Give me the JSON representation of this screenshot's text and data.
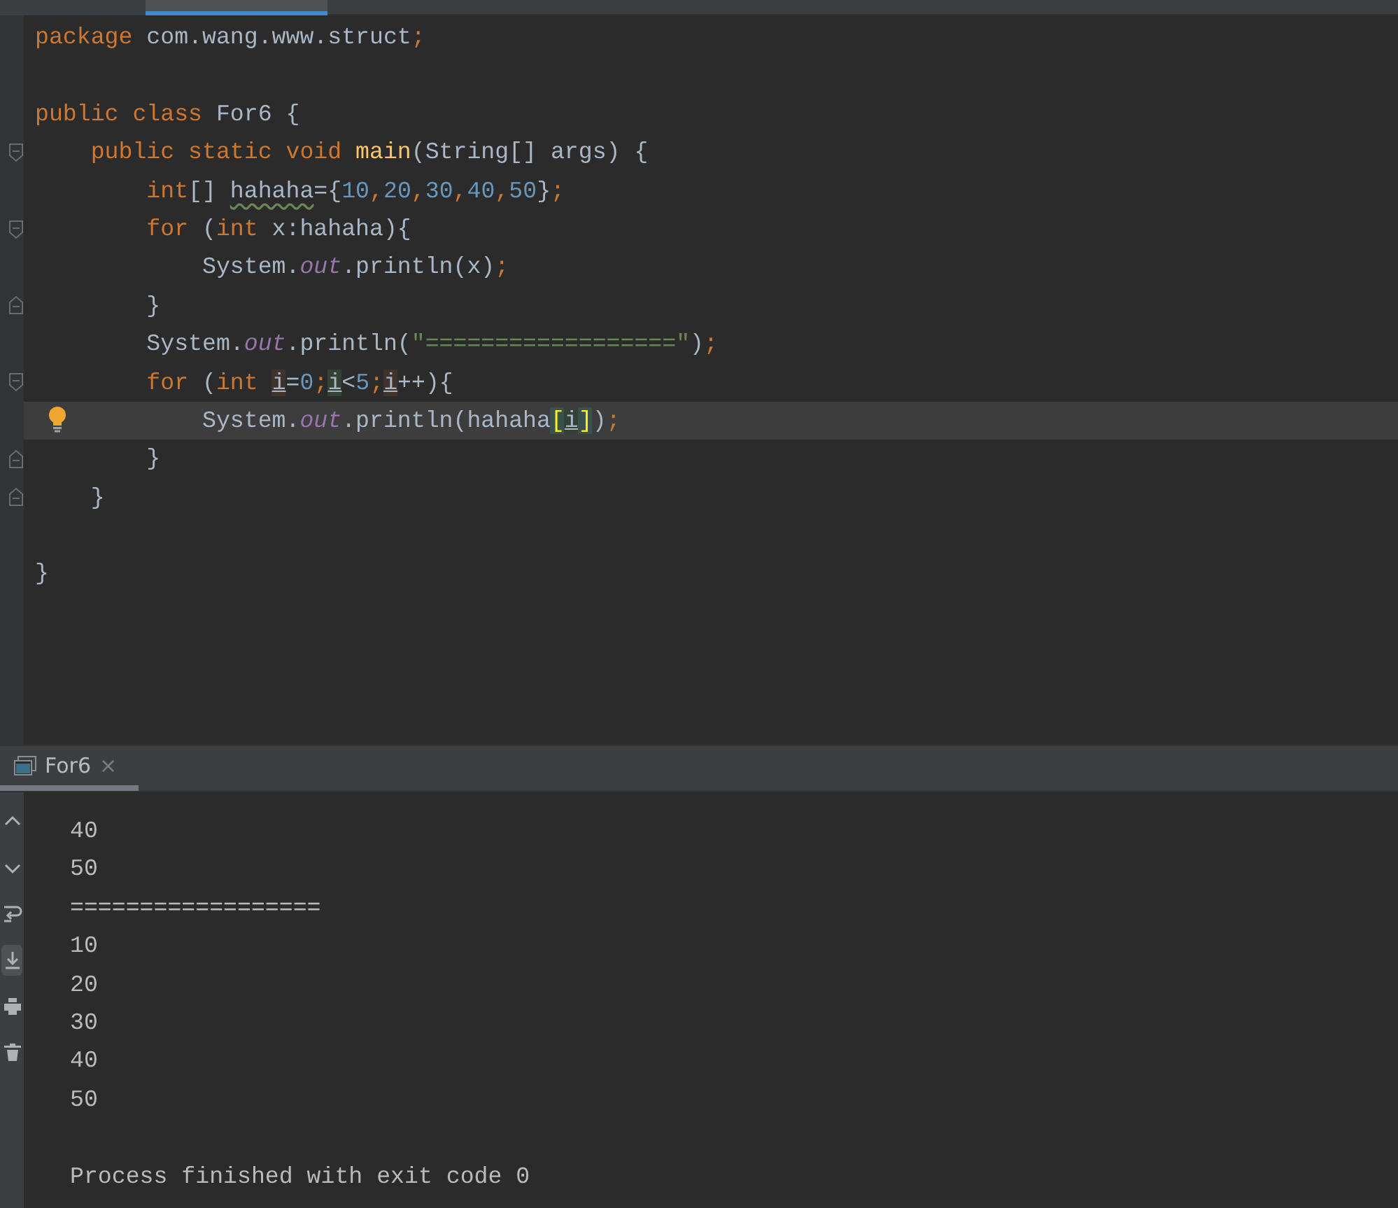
{
  "editor_tabs": [
    {
      "selected": false
    },
    {
      "selected": true
    }
  ],
  "code_lines": [
    {
      "kind": "plain",
      "current": false,
      "tokens": [
        {
          "kind": "kw",
          "text": "package"
        },
        {
          "kind": "id",
          "text": " com.wang.www.struct"
        },
        {
          "kind": "kw",
          "text": ";"
        }
      ]
    },
    {
      "kind": "plain",
      "current": false
    },
    {
      "kind": "plain",
      "current": false,
      "tokens": [
        {
          "kind": "kw",
          "text": "public class"
        },
        {
          "kind": "id",
          "text": " For6 {"
        }
      ]
    },
    {
      "kind": "fold-start",
      "current": false,
      "tokens": [
        {
          "kind": "kw",
          "text": "    public static void "
        },
        {
          "kind": "fn",
          "text": "main"
        },
        {
          "kind": "id",
          "text": "(String[] args) {"
        }
      ]
    },
    {
      "kind": "plain",
      "current": false,
      "tokens": [
        {
          "kind": "kw",
          "text": "        int"
        },
        {
          "kind": "id",
          "text": "[] "
        },
        {
          "kind": "warn",
          "text": "hahaha"
        },
        {
          "kind": "id",
          "text": "={"
        },
        {
          "kind": "num",
          "text": "10"
        },
        {
          "kind": "kw",
          "text": ","
        },
        {
          "kind": "num",
          "text": "20"
        },
        {
          "kind": "kw",
          "text": ","
        },
        {
          "kind": "num",
          "text": "30"
        },
        {
          "kind": "kw",
          "text": ","
        },
        {
          "kind": "num",
          "text": "40"
        },
        {
          "kind": "kw",
          "text": ","
        },
        {
          "kind": "num",
          "text": "50"
        },
        {
          "kind": "id",
          "text": "}"
        },
        {
          "kind": "kw",
          "text": ";"
        }
      ]
    },
    {
      "kind": "fold-start",
      "current": false,
      "tokens": [
        {
          "kind": "kw",
          "text": "        for"
        },
        {
          "kind": "id",
          "text": " ("
        },
        {
          "kind": "kw",
          "text": "int"
        },
        {
          "kind": "id",
          "text": " x:hahaha){"
        }
      ]
    },
    {
      "kind": "plain",
      "current": false,
      "tokens": [
        {
          "kind": "id",
          "text": "            System."
        },
        {
          "kind": "field",
          "text": "out"
        },
        {
          "kind": "id",
          "text": ".println(x)"
        },
        {
          "kind": "kw",
          "text": ";"
        }
      ]
    },
    {
      "kind": "fold-end",
      "current": false,
      "tokens": [
        {
          "kind": "id",
          "text": "        }"
        }
      ]
    },
    {
      "kind": "plain",
      "current": false,
      "tokens": [
        {
          "kind": "id",
          "text": "        System."
        },
        {
          "kind": "field",
          "text": "out"
        },
        {
          "kind": "id",
          "text": ".println("
        },
        {
          "kind": "str",
          "text": "\"==================\""
        },
        {
          "kind": "id",
          "text": ")"
        },
        {
          "kind": "kw",
          "text": ";"
        }
      ]
    },
    {
      "kind": "fold-start",
      "current": false,
      "tokens": [
        {
          "kind": "kw",
          "text": "        for"
        },
        {
          "kind": "id",
          "text": " ("
        },
        {
          "kind": "kw",
          "text": "int "
        },
        {
          "kind": "var-write",
          "text": "i"
        },
        {
          "kind": "id",
          "text": "="
        },
        {
          "kind": "num",
          "text": "0"
        },
        {
          "kind": "kw",
          "text": ";"
        },
        {
          "kind": "var-read",
          "text": "i"
        },
        {
          "kind": "id",
          "text": "<"
        },
        {
          "kind": "num",
          "text": "5"
        },
        {
          "kind": "kw",
          "text": ";"
        },
        {
          "kind": "var-write",
          "text": "i"
        },
        {
          "kind": "id",
          "text": "++){"
        }
      ]
    },
    {
      "kind": "bulb",
      "current": true,
      "tokens": [
        {
          "kind": "id",
          "text": "            System."
        },
        {
          "kind": "field",
          "text": "out"
        },
        {
          "kind": "id",
          "text": ".println(hahaha"
        },
        {
          "kind": "match",
          "text": "["
        },
        {
          "kind": "var-read",
          "text": "i"
        },
        {
          "kind": "match",
          "text": "]"
        },
        {
          "kind": "id",
          "text": ")"
        },
        {
          "kind": "kw",
          "text": ";"
        }
      ]
    },
    {
      "kind": "fold-end",
      "current": false,
      "tokens": [
        {
          "kind": "id",
          "text": "        }"
        }
      ]
    },
    {
      "kind": "fold-end",
      "current": false,
      "tokens": [
        {
          "kind": "id",
          "text": "    }"
        }
      ]
    },
    {
      "kind": "plain",
      "current": false
    },
    {
      "kind": "plain",
      "current": false,
      "tokens": [
        {
          "kind": "id",
          "text": "}"
        }
      ]
    }
  ],
  "run_tab": {
    "label": "For6",
    "close": "×",
    "selected": true
  },
  "console_tools": [
    {
      "kind": "up",
      "selected": false
    },
    {
      "kind": "down",
      "selected": false
    },
    {
      "kind": "wrap",
      "selected": false
    },
    {
      "kind": "scroll-end",
      "selected": true
    },
    {
      "kind": "print",
      "selected": false
    },
    {
      "kind": "trash",
      "selected": false
    }
  ],
  "console_lines": [
    {
      "kind": "output",
      "text": "40"
    },
    {
      "kind": "output",
      "text": "50"
    },
    {
      "kind": "output",
      "text": "=================="
    },
    {
      "kind": "output",
      "text": "10"
    },
    {
      "kind": "output",
      "text": "20"
    },
    {
      "kind": "output",
      "text": "30"
    },
    {
      "kind": "output",
      "text": "40"
    },
    {
      "kind": "output",
      "text": "50"
    },
    {
      "kind": "exit",
      "text": "Process finished with exit code 0"
    }
  ]
}
